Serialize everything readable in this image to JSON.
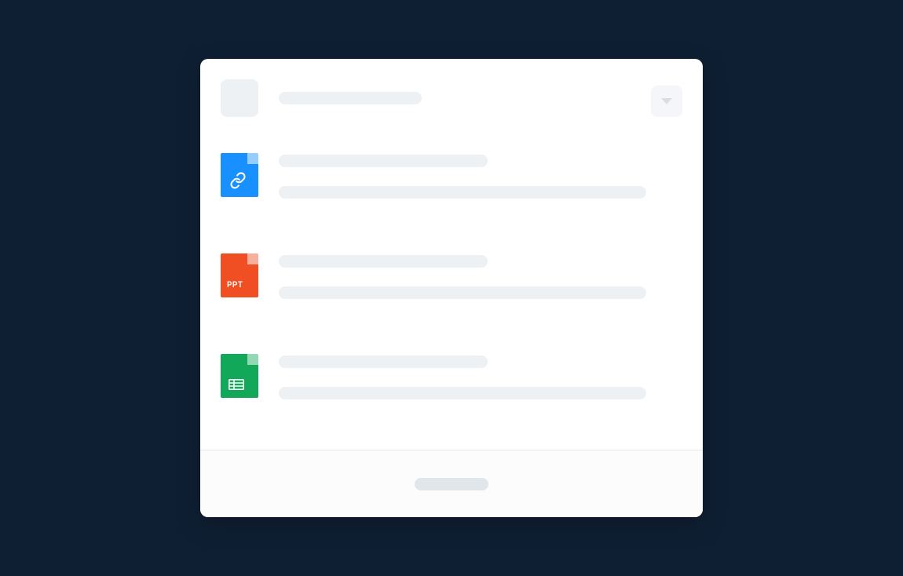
{
  "header": {
    "title": "",
    "dropdown_label": ""
  },
  "items": [
    {
      "kind": "link",
      "badge": "",
      "title": "",
      "subtitle": "",
      "icon_color": "#1890ff"
    },
    {
      "kind": "ppt",
      "badge": "PPT",
      "title": "",
      "subtitle": "",
      "icon_color": "#f04f23"
    },
    {
      "kind": "sheet",
      "badge": "",
      "title": "",
      "subtitle": "",
      "icon_color": "#11a859"
    }
  ],
  "footer": {
    "action_label": ""
  },
  "colors": {
    "page_bg": "#0f1f33",
    "card_bg": "#ffffff",
    "skeleton": "#eef1f4"
  }
}
